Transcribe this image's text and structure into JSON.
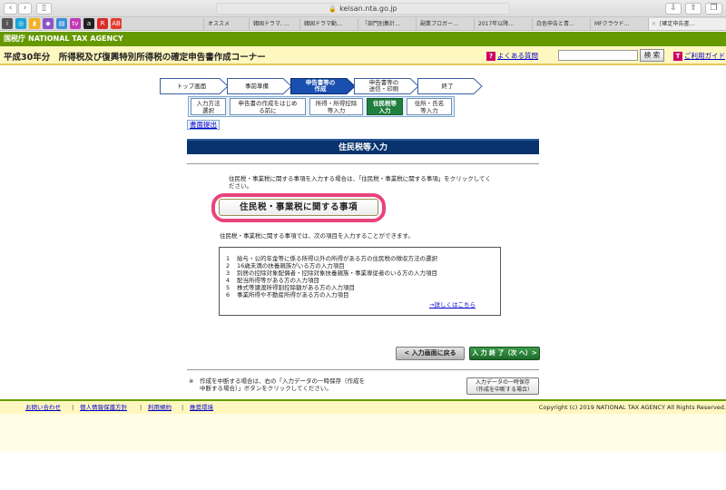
{
  "browser": {
    "url": "keisan.nta.go.jp",
    "tabs": [
      "オススメ",
      "韓国ドラマ, …",
      "韓国ドラマ動…",
      "「部門別集計…",
      "副業ブロガー…",
      "2017年以降…",
      "白色申告と青…",
      "MFクラウド…",
      "[確定申告書…"
    ]
  },
  "header": {
    "agency_kanji": "国税庁",
    "agency_name": "NATIONAL TAX AGENCY",
    "page_title": "平成30年分　所得税及び復興特別所得税の確定申告書作成コーナー",
    "faq_label": "よくある質問",
    "search_button": "検 索",
    "guide_label": "ご利用ガイド"
  },
  "steps": [
    {
      "label": "トップ画面"
    },
    {
      "label": "事前準備"
    },
    {
      "label": "申告書等の",
      "label2": "作成"
    },
    {
      "label": "申告書等の",
      "label2": "送信・印刷"
    },
    {
      "label": "終了"
    }
  ],
  "substeps": [
    {
      "label": "入力方法",
      "label2": "選択"
    },
    {
      "label": "申告書の作成をはじめ",
      "label2": "る前に"
    },
    {
      "label": "所得・所得控除",
      "label2": "等入力"
    },
    {
      "label": "住民税等",
      "label2": "入力"
    },
    {
      "label": "住所・氏名",
      "label2": "等入力"
    }
  ],
  "submit_link": "書面提出",
  "main": {
    "section_title": "住民税等入力",
    "description_line1": "住民税・事業税に関する事項を入力する場合は、「住民税・事業税に関する事項」をクリックしてく",
    "description_line2": "ださい。",
    "jumin_button": "住民税・事業税に関する事項",
    "intro": "住民税・事業税に関する事項では、次の項目を入力することができます。",
    "items": [
      {
        "num": "1",
        "text": "給与・公的年金等に係る所得以外の所得がある方の住民税の徴収方法の選択"
      },
      {
        "num": "2",
        "text": "16歳未満の扶養親族がいる方の入力項目"
      },
      {
        "num": "3",
        "text": "別居の控除対象配偶者・控除対象扶養親族・事業専従者のいる方の入力項目"
      },
      {
        "num": "4",
        "text": "配当所得等がある方の入力項目"
      },
      {
        "num": "5",
        "text": "株式等譲渡所得割控除額がある方の入力項目"
      },
      {
        "num": "6",
        "text": "事業所得や不動産所得がある方の入力項目"
      }
    ],
    "details_link": "→詳しくはこちら",
    "back_button": "< 入力画面に戻る",
    "next_button": "入 力 終 了（次 へ）>",
    "note_mark": "※",
    "note_line1": "作成を中断する場合は、右の「入力データの一時保存（作成を",
    "note_line2": "中断する場合）」ボタンをクリックしてください。",
    "tempsave_line1": "入力データの一時保存",
    "tempsave_line2": "（作成を中断する場合）"
  },
  "footer": {
    "links": [
      "お問い合わせ",
      "個人情報保護方針",
      "利用規約",
      "推奨環境"
    ],
    "copyright": "Copyright (c) 2019 NATIONAL TAX AGENCY All Rights Reserved."
  },
  "colors": {
    "agency_green": "#669900",
    "title_yellow": "#fff7c0",
    "section_navy": "#08336c",
    "current_step_blue": "#1a4fb0",
    "current_substep_green": "#207f3f",
    "highlight_pink": "#e8437c",
    "link_blue": "#0000cc"
  },
  "icons": {
    "back": "chevron-left-icon",
    "forward": "chevron-right-icon",
    "sidebar": "sidebar-icon",
    "lock": "lock-icon",
    "download": "download-icon",
    "share": "share-icon",
    "tabs": "tabs-icon",
    "faq": "question-icon",
    "guide": "guide-icon"
  }
}
